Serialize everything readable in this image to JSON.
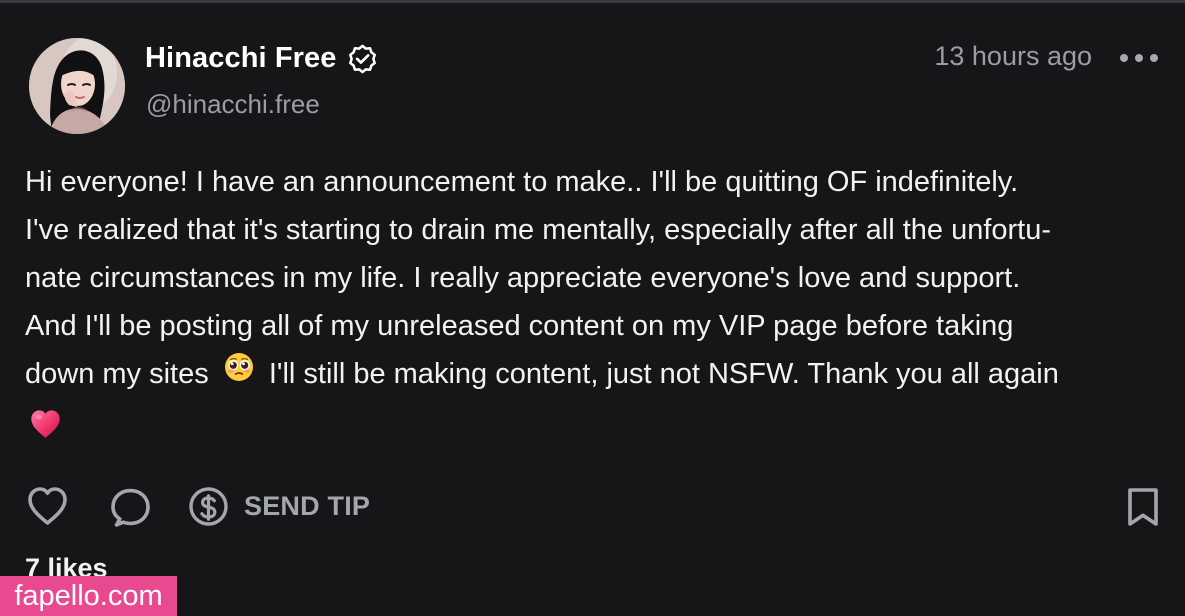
{
  "post": {
    "display_name": "Hinacchi Free",
    "handle": "@hinacchi.free",
    "timestamp": "13 hours ago",
    "body_lines": [
      "Hi everyone! I have an announcement to make.. I'll be quitting OF indefinitely.",
      "I've realized that it's starting to drain me mentally, especially after all the unfortu-",
      "nate circumstances in my life. I really appreciate everyone's love and support.",
      "And I'll be posting all of my unreleased content on my VIP page before taking"
    ],
    "body_line_5_before_emoji": "down my sites",
    "body_line_5_after_emoji": "I'll still be making content, just not NSFW. Thank you all again",
    "likes_text": "7 likes"
  },
  "actions": {
    "send_tip_label": "SEND TIP"
  },
  "watermark": {
    "text": "fapello.com"
  },
  "icons": {
    "verified": "verified-badge-icon",
    "more": "more-dots-icon",
    "like": "heart-outline-icon",
    "comment": "comment-bubble-icon",
    "tip": "dollar-coin-icon",
    "bookmark": "bookmark-icon",
    "pleading_emoji": "pleading-face-emoji",
    "heart_emoji": "red-heart-emoji"
  },
  "colors": {
    "background": "#161618",
    "primary_text": "#f2f2f4",
    "secondary_text": "#9b9ca4",
    "watermark": "#e94a8f"
  }
}
